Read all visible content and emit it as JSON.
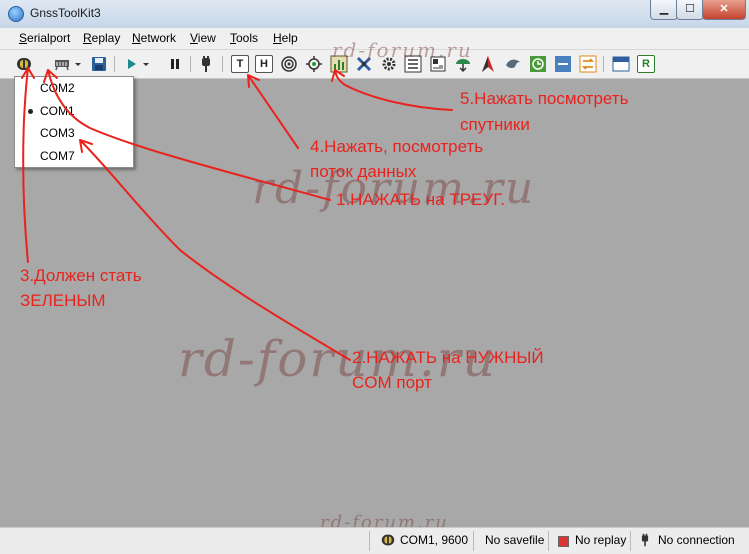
{
  "window": {
    "title": "GnssToolKit3",
    "min_glyph": "▁",
    "max_glyph": "☐",
    "close_glyph": "✕"
  },
  "menu": [
    "Serialport",
    "Replay",
    "Network",
    "View",
    "Tools",
    "Help"
  ],
  "toolbar": {
    "box_glyphs": {
      "text_view": "T",
      "hex_view": "H",
      "report": "R"
    },
    "icons": [
      "serialport-icon",
      "serial-settings-icon",
      "dropdown-arrow-icon",
      "save-icon",
      "play-icon",
      "dropdown-arrow-icon",
      "pause-icon",
      "connect-plug-icon",
      "text-view-icon",
      "hex-view-icon",
      "signal-target-icon",
      "position-target-icon",
      "satellite-view-icon",
      "satellite-icon",
      "gear-icon",
      "list-icon",
      "document-icon",
      "globe-icon",
      "compass-icon",
      "bird-icon",
      "clock-icon",
      "dps-icon",
      "refresh-icon",
      "layout-icon",
      "report-icon"
    ]
  },
  "com_menu": {
    "items": [
      "COM2",
      "COM1",
      "COM3",
      "COM7"
    ],
    "selected": "COM1"
  },
  "watermarks": {
    "text": "rd-forum.ru"
  },
  "annotations": {
    "a1": "1.НАЖАТЬ на ТРЕУГ.",
    "a2_line1": "2.НАЖАТЬ на НУЖНЫЙ",
    "a2_line2": "COM порт",
    "a3_line1": "3.Должен стать",
    "a3_line2": "ЗЕЛЕНЫМ",
    "a4_line1": "4.Нажать, посмотреть",
    "a4_line2": "поток данных",
    "a5_line1": "5.Нажать посмотреть",
    "a5_line2": "спутники"
  },
  "colors": {
    "annotation_red": "#e8231e",
    "workspace_gray": "#a8a8a8"
  },
  "status": {
    "port": "COM1, 9600",
    "savefile": "No savefile",
    "replay": "No replay",
    "connection": "No connection"
  }
}
